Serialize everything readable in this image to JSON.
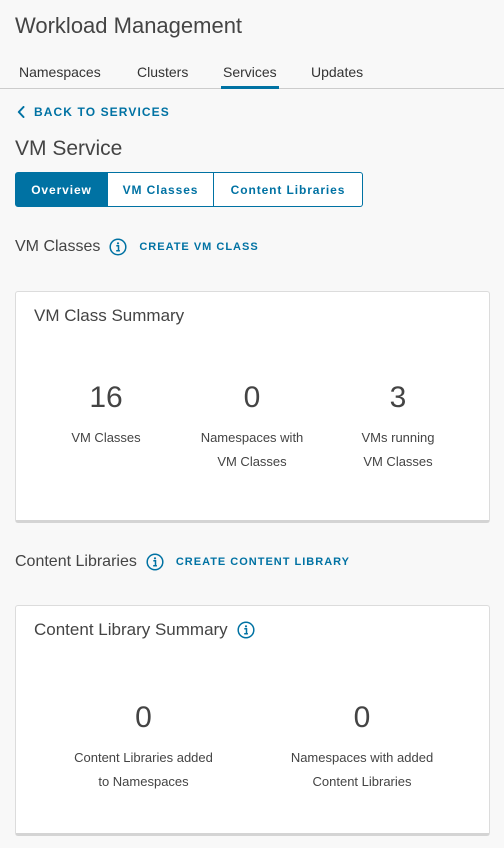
{
  "header": {
    "title": "Workload Management"
  },
  "tabs": [
    {
      "label": "Namespaces"
    },
    {
      "label": "Clusters"
    },
    {
      "label": "Services",
      "active": true
    },
    {
      "label": "Updates"
    }
  ],
  "back_link": {
    "label": "BACK TO SERVICES"
  },
  "service": {
    "title": "VM Service"
  },
  "segmented": {
    "options": [
      {
        "label": "Overview",
        "active": true
      },
      {
        "label": "VM Classes"
      },
      {
        "label": "Content Libraries"
      }
    ]
  },
  "vm_classes_section": {
    "label": "VM Classes",
    "action": "CREATE VM CLASS",
    "card": {
      "title": "VM Class Summary",
      "stats": [
        {
          "value": "16",
          "label_line1": "VM Classes",
          "label_line2": ""
        },
        {
          "value": "0",
          "label_line1": "Namespaces with",
          "label_line2": "VM Classes"
        },
        {
          "value": "3",
          "label_line1": "VMs running",
          "label_line2": "VM Classes"
        }
      ]
    }
  },
  "content_libraries_section": {
    "label": "Content Libraries",
    "action": "CREATE CONTENT LIBRARY",
    "card": {
      "title": "Content Library Summary",
      "stats": [
        {
          "value": "0",
          "label_line1": "Content Libraries added",
          "label_line2": "to Namespaces"
        },
        {
          "value": "0",
          "label_line1": "Namespaces with added",
          "label_line2": "Content Libraries"
        }
      ]
    }
  },
  "colors": {
    "accent": "#0072a3",
    "background": "#f8f8f8",
    "text": "#444444"
  },
  "icons": {
    "info": "info-circle-icon",
    "back": "chevron-left-icon"
  }
}
